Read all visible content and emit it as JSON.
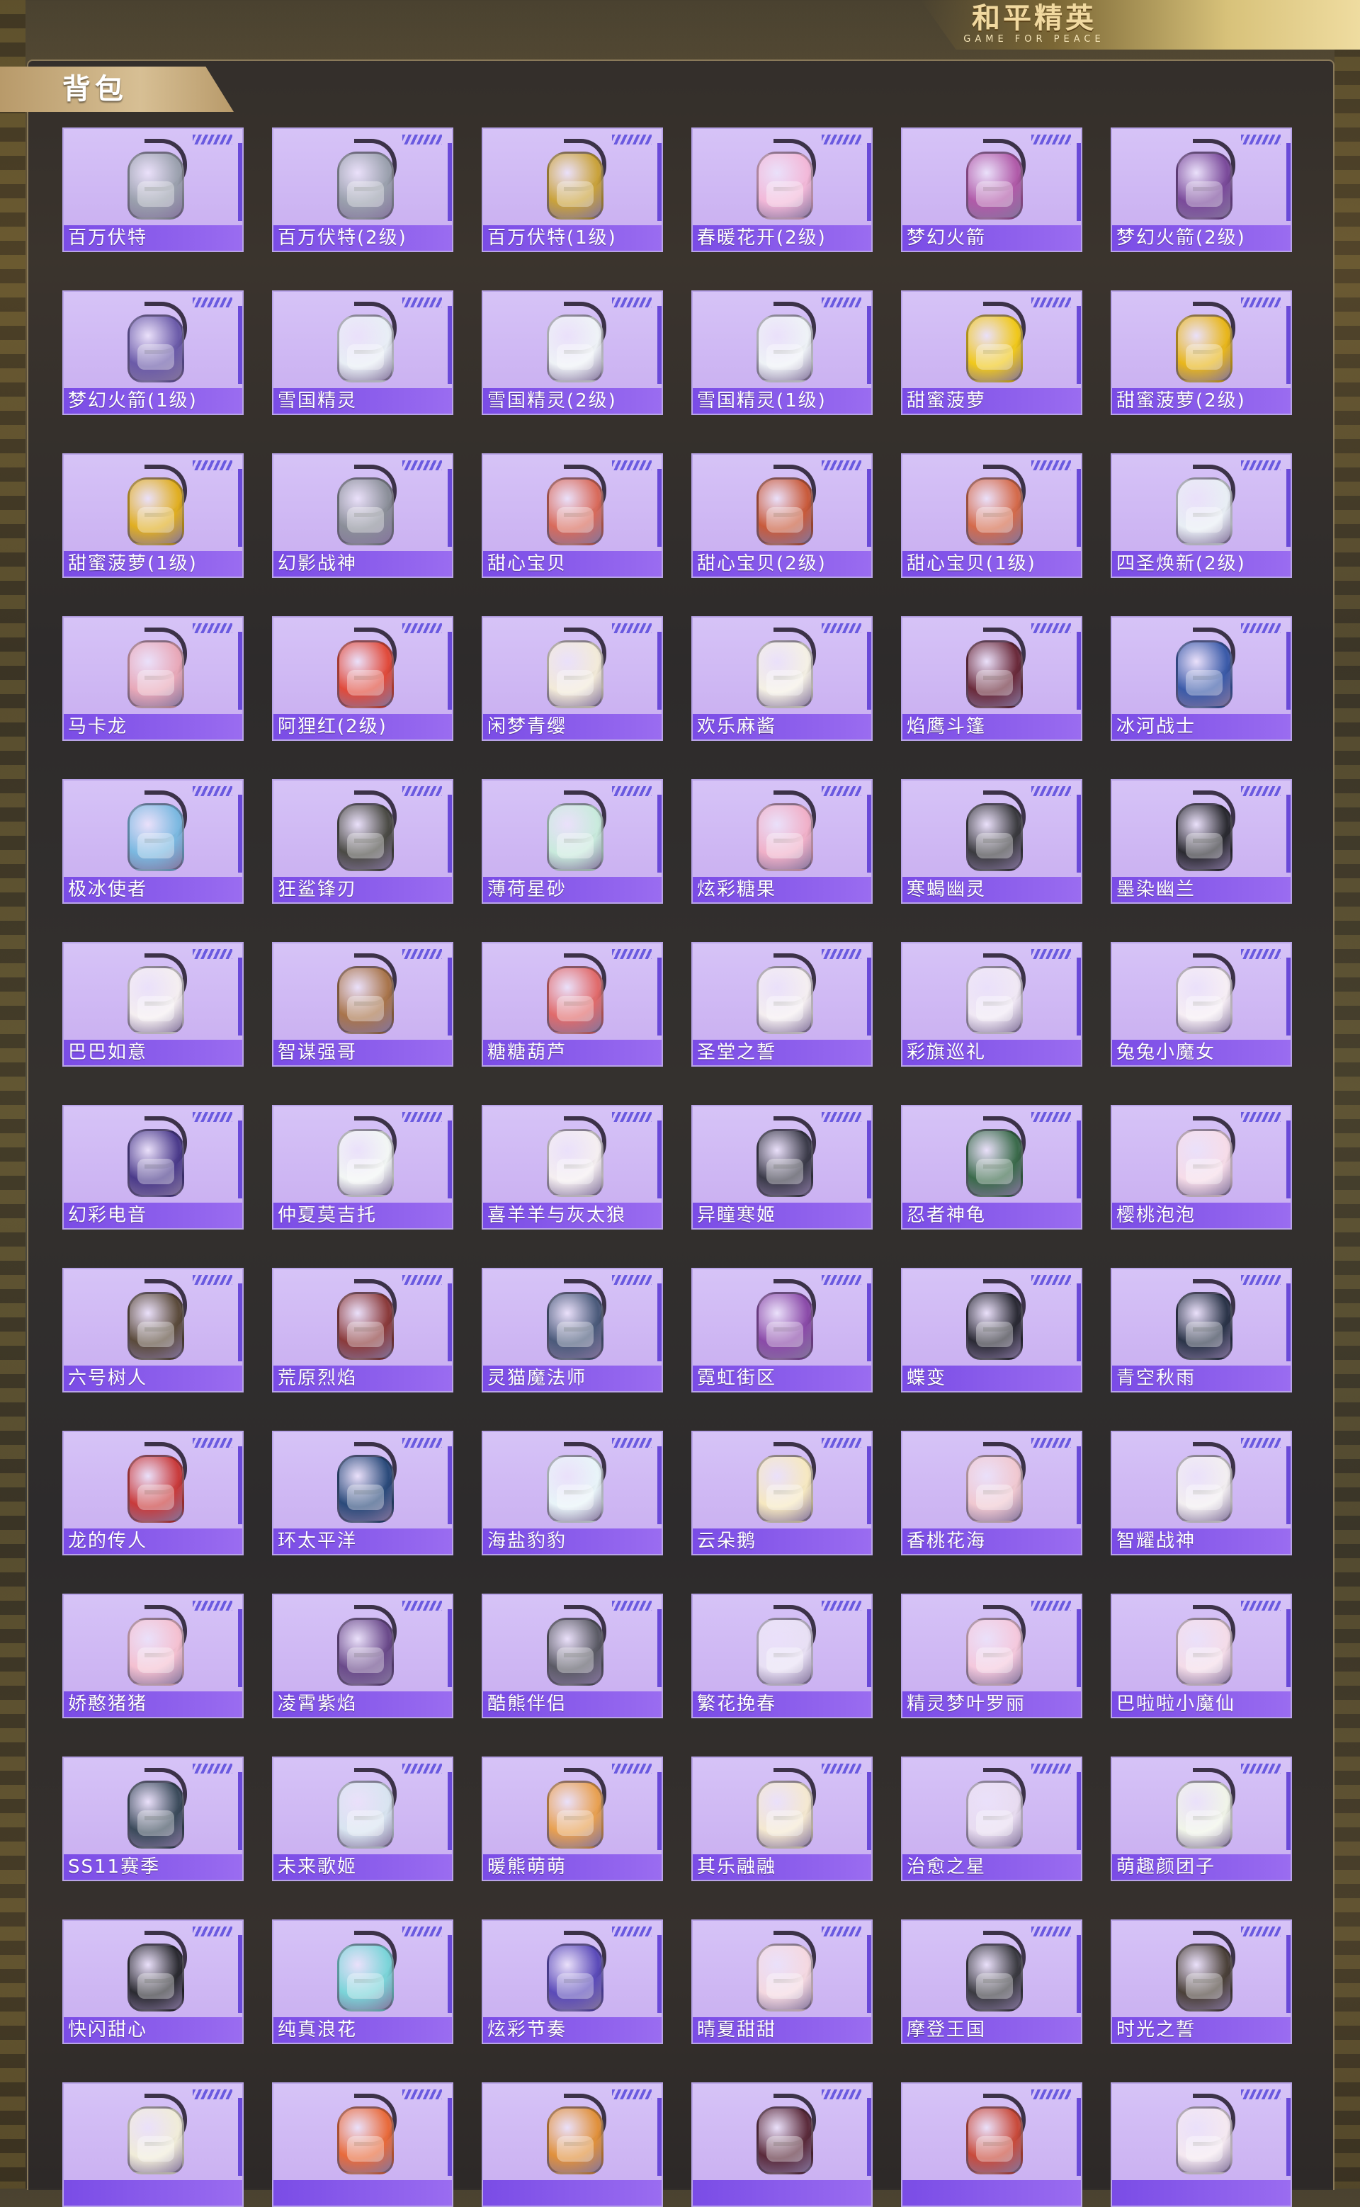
{
  "logo": {
    "title": "和平精英",
    "subtitle": "GAME FOR PEACE"
  },
  "header": {
    "title": "背包"
  },
  "items": [
    {
      "name": "百万伏特",
      "color": "#9aa0ad",
      "icon": "backpack-icon"
    },
    {
      "name": "百万伏特(2级)",
      "color": "#9aa0ad",
      "icon": "backpack-icon"
    },
    {
      "name": "百万伏特(1级)",
      "color": "#c9a23a",
      "icon": "backpack-icon"
    },
    {
      "name": "春暖花开(2级)",
      "color": "#f2b8d8",
      "icon": "backpack-icon"
    },
    {
      "name": "梦幻火箭",
      "color": "#b05aa8",
      "icon": "backpack-icon"
    },
    {
      "name": "梦幻火箭(2级)",
      "color": "#7a4a9a",
      "icon": "backpack-icon"
    },
    {
      "name": "梦幻火箭(1级)",
      "color": "#6a5aa8",
      "icon": "backpack-icon"
    },
    {
      "name": "雪国精灵",
      "color": "#e8eef5",
      "icon": "backpack-icon"
    },
    {
      "name": "雪国精灵(2级)",
      "color": "#eef2f6",
      "icon": "backpack-icon"
    },
    {
      "name": "雪国精灵(1级)",
      "color": "#eef2f6",
      "icon": "backpack-icon"
    },
    {
      "name": "甜蜜菠萝",
      "color": "#f0c81a",
      "icon": "backpack-icon"
    },
    {
      "name": "甜蜜菠萝(2级)",
      "color": "#e8b61a",
      "icon": "backpack-icon"
    },
    {
      "name": "甜蜜菠萝(1级)",
      "color": "#e0ae20",
      "icon": "backpack-icon"
    },
    {
      "name": "幻影战神",
      "color": "#8a8e98",
      "icon": "backpack-icon"
    },
    {
      "name": "甜心宝贝",
      "color": "#d86a5a",
      "icon": "backpack-icon"
    },
    {
      "name": "甜心宝贝(2级)",
      "color": "#c85a3a",
      "icon": "backpack-icon"
    },
    {
      "name": "甜心宝贝(1级)",
      "color": "#d46a4a",
      "icon": "backpack-icon"
    },
    {
      "name": "四圣焕新(2级)",
      "color": "#e8eef4",
      "icon": "backpack-icon"
    },
    {
      "name": "马卡龙",
      "color": "#e8a8b8",
      "icon": "backpack-icon"
    },
    {
      "name": "阿狸红(2级)",
      "color": "#e04a3a",
      "icon": "backpack-icon"
    },
    {
      "name": "闲梦青缨",
      "color": "#f2ead8",
      "icon": "backpack-icon"
    },
    {
      "name": "欢乐麻酱",
      "color": "#f4f0e4",
      "icon": "backpack-icon"
    },
    {
      "name": "焰鹰斗篷",
      "color": "#6a2a3a",
      "icon": "backpack-icon"
    },
    {
      "name": "冰河战士",
      "color": "#3a5aa8",
      "icon": "backpack-icon"
    },
    {
      "name": "极冰使者",
      "color": "#7ab8e0",
      "icon": "backpack-icon"
    },
    {
      "name": "狂鲨锋刃",
      "color": "#4a4a44",
      "icon": "backpack-icon"
    },
    {
      "name": "薄荷星砂",
      "color": "#c8eadc",
      "icon": "backpack-icon"
    },
    {
      "name": "炫彩糖果",
      "color": "#f0b0c8",
      "icon": "backpack-icon"
    },
    {
      "name": "寒蝎幽灵",
      "color": "#3a3a3e",
      "icon": "backpack-icon"
    },
    {
      "name": "墨染幽兰",
      "color": "#2a2a30",
      "icon": "backpack-icon"
    },
    {
      "name": "巴巴如意",
      "color": "#f4eef0",
      "icon": "backpack-icon"
    },
    {
      "name": "智谋强哥",
      "color": "#a8744a",
      "icon": "backpack-icon"
    },
    {
      "name": "糖糖葫芦",
      "color": "#e06a6a",
      "icon": "backpack-icon"
    },
    {
      "name": "圣堂之誓",
      "color": "#f4eef0",
      "icon": "backpack-icon"
    },
    {
      "name": "彩旗巡礼",
      "color": "#f0e8f4",
      "icon": "backpack-icon"
    },
    {
      "name": "兔兔小魔女",
      "color": "#f6eef4",
      "icon": "backpack-icon"
    },
    {
      "name": "幻彩电音",
      "color": "#4a3a8a",
      "icon": "backpack-icon"
    },
    {
      "name": "仲夏莫吉托",
      "color": "#f2f6f4",
      "icon": "backpack-icon"
    },
    {
      "name": "喜羊羊与灰太狼",
      "color": "#f4eef0",
      "icon": "backpack-icon"
    },
    {
      "name": "异瞳寒姬",
      "color": "#3a3a48",
      "icon": "backpack-icon"
    },
    {
      "name": "忍者神龟",
      "color": "#3a6a4a",
      "icon": "backpack-icon"
    },
    {
      "name": "樱桃泡泡",
      "color": "#f6dce8",
      "icon": "backpack-icon"
    },
    {
      "name": "六号树人",
      "color": "#5a4a3a",
      "icon": "backpack-icon"
    },
    {
      "name": "荒原烈焰",
      "color": "#8a3a3a",
      "icon": "backpack-icon"
    },
    {
      "name": "灵猫魔法师",
      "color": "#4a5a7a",
      "icon": "backpack-icon"
    },
    {
      "name": "霓虹街区",
      "color": "#8a4aa8",
      "icon": "backpack-icon"
    },
    {
      "name": "蝶变",
      "color": "#2a2a34",
      "icon": "backpack-icon"
    },
    {
      "name": "青空秋雨",
      "color": "#2a3448",
      "icon": "backpack-icon"
    },
    {
      "name": "龙的传人",
      "color": "#c83a3a",
      "icon": "backpack-icon"
    },
    {
      "name": "环太平洋",
      "color": "#2a4a7a",
      "icon": "backpack-icon"
    },
    {
      "name": "海盐豹豹",
      "color": "#e8f4f8",
      "icon": "backpack-icon"
    },
    {
      "name": "云朵鹅",
      "color": "#f6e8c0",
      "icon": "backpack-icon"
    },
    {
      "name": "香桃花海",
      "color": "#f0c8d0",
      "icon": "backpack-icon"
    },
    {
      "name": "智耀战神",
      "color": "#f2eef0",
      "icon": "backpack-icon"
    },
    {
      "name": "娇憨猪猪",
      "color": "#f4c0d0",
      "icon": "backpack-icon"
    },
    {
      "name": "凌霄紫焰",
      "color": "#6a4a8a",
      "icon": "backpack-icon"
    },
    {
      "name": "酷熊伴侣",
      "color": "#5a5a64",
      "icon": "backpack-icon"
    },
    {
      "name": "繁花挽春",
      "color": "#e8e0f4",
      "icon": "backpack-icon"
    },
    {
      "name": "精灵梦叶罗丽",
      "color": "#f4c8dc",
      "icon": "backpack-icon"
    },
    {
      "name": "巴啦啦小魔仙",
      "color": "#f4dce8",
      "icon": "backpack-icon"
    },
    {
      "name": "SS11赛季",
      "color": "#3a4a5a",
      "icon": "backpack-icon"
    },
    {
      "name": "未来歌姬",
      "color": "#d8e4f0",
      "icon": "backpack-icon"
    },
    {
      "name": "暖熊萌萌",
      "color": "#e8a050",
      "icon": "backpack-icon"
    },
    {
      "name": "其乐融融",
      "color": "#f4e8d0",
      "icon": "backpack-icon"
    },
    {
      "name": "治愈之星",
      "color": "#e8dcf0",
      "icon": "backpack-icon"
    },
    {
      "name": "萌趣颜团子",
      "color": "#f0f4e8",
      "icon": "backpack-icon"
    },
    {
      "name": "快闪甜心",
      "color": "#2a2a30",
      "icon": "backpack-icon"
    },
    {
      "name": "纯真浪花",
      "color": "#7ad4d8",
      "icon": "backpack-icon"
    },
    {
      "name": "炫彩节奏",
      "color": "#5a4ab8",
      "icon": "backpack-icon"
    },
    {
      "name": "晴夏甜甜",
      "color": "#f4d8e0",
      "icon": "backpack-icon"
    },
    {
      "name": "摩登王国",
      "color": "#3a3a40",
      "icon": "backpack-icon"
    },
    {
      "name": "时光之誓",
      "color": "#4a4038",
      "icon": "backpack-icon"
    },
    {
      "name": "",
      "color": "#f0ecd8",
      "icon": "backpack-icon"
    },
    {
      "name": "",
      "color": "#e86a3a",
      "icon": "backpack-icon"
    },
    {
      "name": "",
      "color": "#e0903a",
      "icon": "backpack-icon"
    },
    {
      "name": "",
      "color": "#5a2a3a",
      "icon": "backpack-icon"
    },
    {
      "name": "",
      "color": "#c84a3a",
      "icon": "backpack-icon"
    },
    {
      "name": "",
      "color": "#f4e8f0",
      "icon": "backpack-icon"
    }
  ]
}
